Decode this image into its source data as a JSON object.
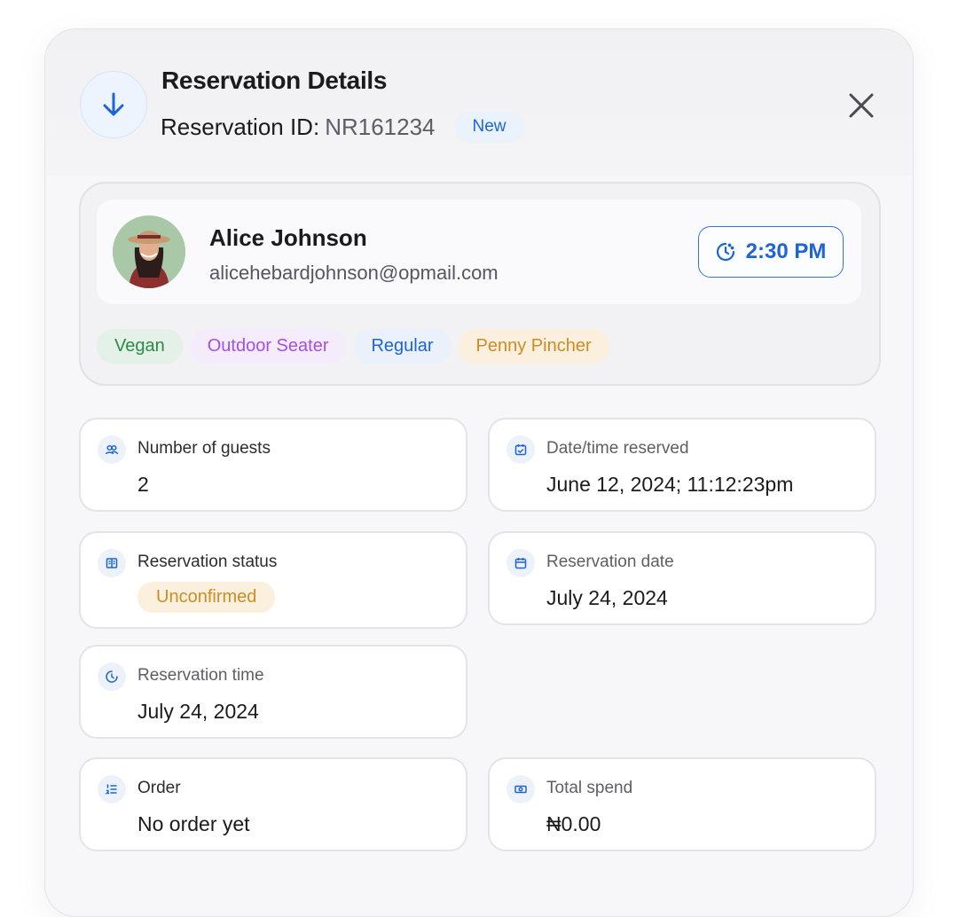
{
  "header": {
    "title": "Reservation Details",
    "reservation_id_label": "Reservation ID",
    "reservation_id_colon": ":",
    "reservation_id_value": "NR161234",
    "status_badge": "New",
    "icon": "arrow-down-icon",
    "close_icon": "close-icon"
  },
  "guest": {
    "name": "Alice Johnson",
    "email": "alicehebardjohnson@opmail.com",
    "time": "2:30 PM",
    "tags": [
      "Vegan",
      "Outdoor Seater",
      "Regular",
      "Penny Pincher"
    ]
  },
  "details": {
    "guests": {
      "label": "Number of guests",
      "value": "2",
      "icon": "users-icon"
    },
    "reserved_at": {
      "label": "Date/time reserved",
      "value": "June 12, 2024; 11:12:23pm",
      "icon": "calendar-check-icon"
    },
    "status": {
      "label": "Reservation status",
      "value": "Unconfirmed",
      "icon": "book-icon"
    },
    "date": {
      "label": "Reservation date",
      "value": "July 24, 2024",
      "icon": "calendar-icon"
    },
    "time": {
      "label": "Reservation time",
      "value": "July 24, 2024",
      "icon": "clock-icon"
    },
    "order": {
      "label": "Order",
      "value": "No order yet",
      "icon": "list-icon"
    },
    "spend": {
      "label": "Total spend",
      "value": "₦0.00",
      "icon": "money-icon"
    }
  },
  "colors": {
    "accent": "#1d65d6",
    "tag_green": "#2c8a45",
    "tag_purple": "#a64fe0",
    "tag_orange": "#cf8a25"
  }
}
